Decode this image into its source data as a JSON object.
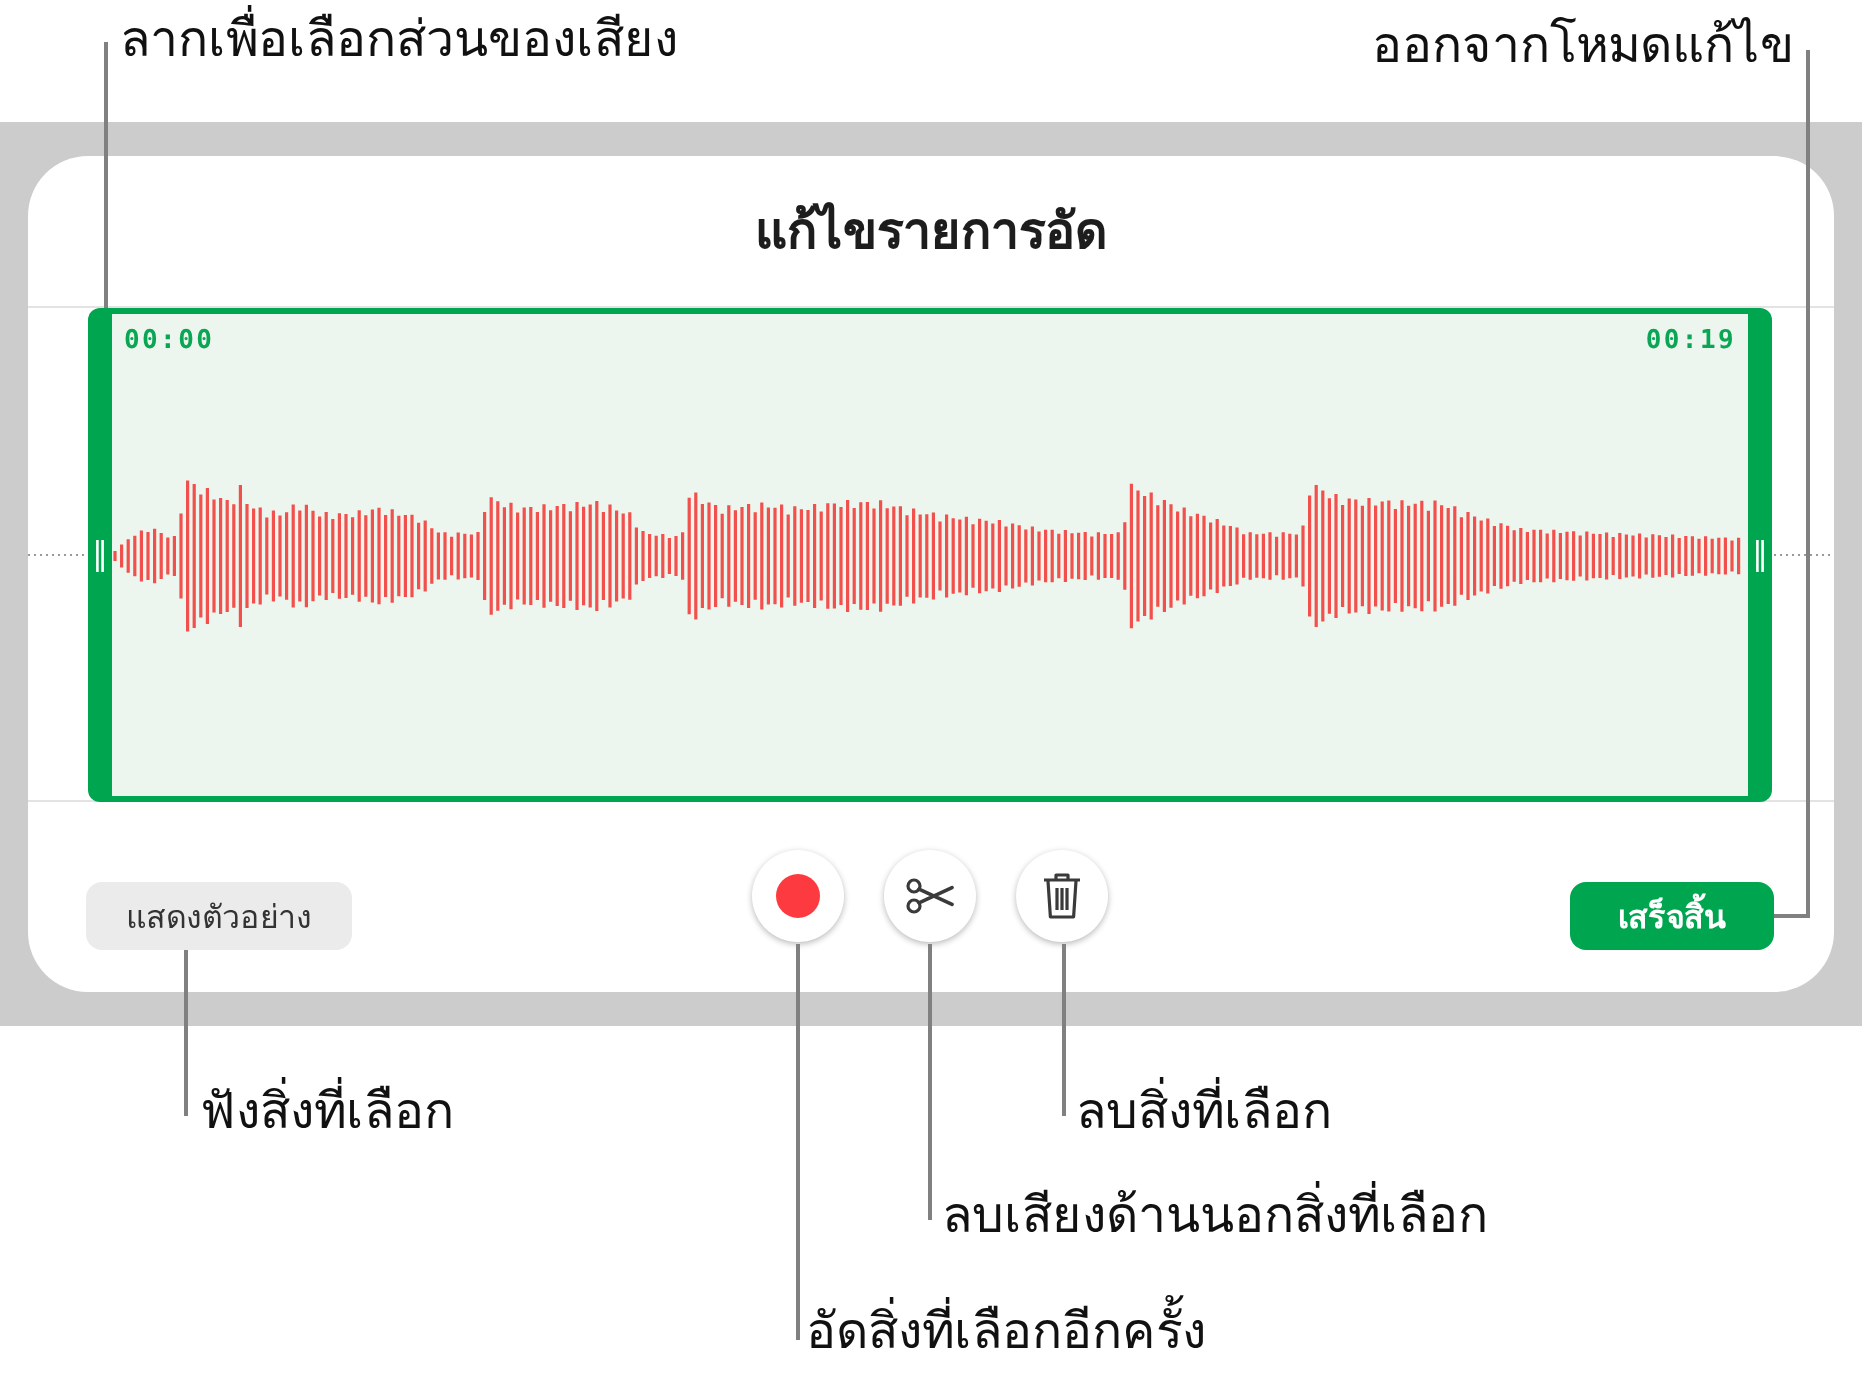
{
  "top_callouts": [
    {
      "text": "ลากเพื่อเลือกส่วนของเสียง"
    },
    {
      "text": "ออกจากโหมดแก้ไข"
    }
  ],
  "dialog": {
    "title": "แก้ไขรายการอัด",
    "selection": {
      "start_time": "00:00",
      "end_time": "00:19"
    },
    "buttons": [
      {
        "kind": "preview",
        "label": "แสดงตัวอย่าง"
      },
      {
        "kind": "record"
      },
      {
        "kind": "trim"
      },
      {
        "kind": "delete"
      },
      {
        "kind": "done",
        "label": "เสร็จสิ้น"
      }
    ]
  },
  "bottom_callouts": [
    {
      "text": "ฟังสิ่งที่เลือก"
    },
    {
      "text": "ลบสิ่งที่เลือก"
    },
    {
      "text": "ลบเสียงด้านนอกสิ่งที่เลือก"
    },
    {
      "text": "อัดสิ่งที่เลือกอีกครั้ง"
    }
  ]
}
